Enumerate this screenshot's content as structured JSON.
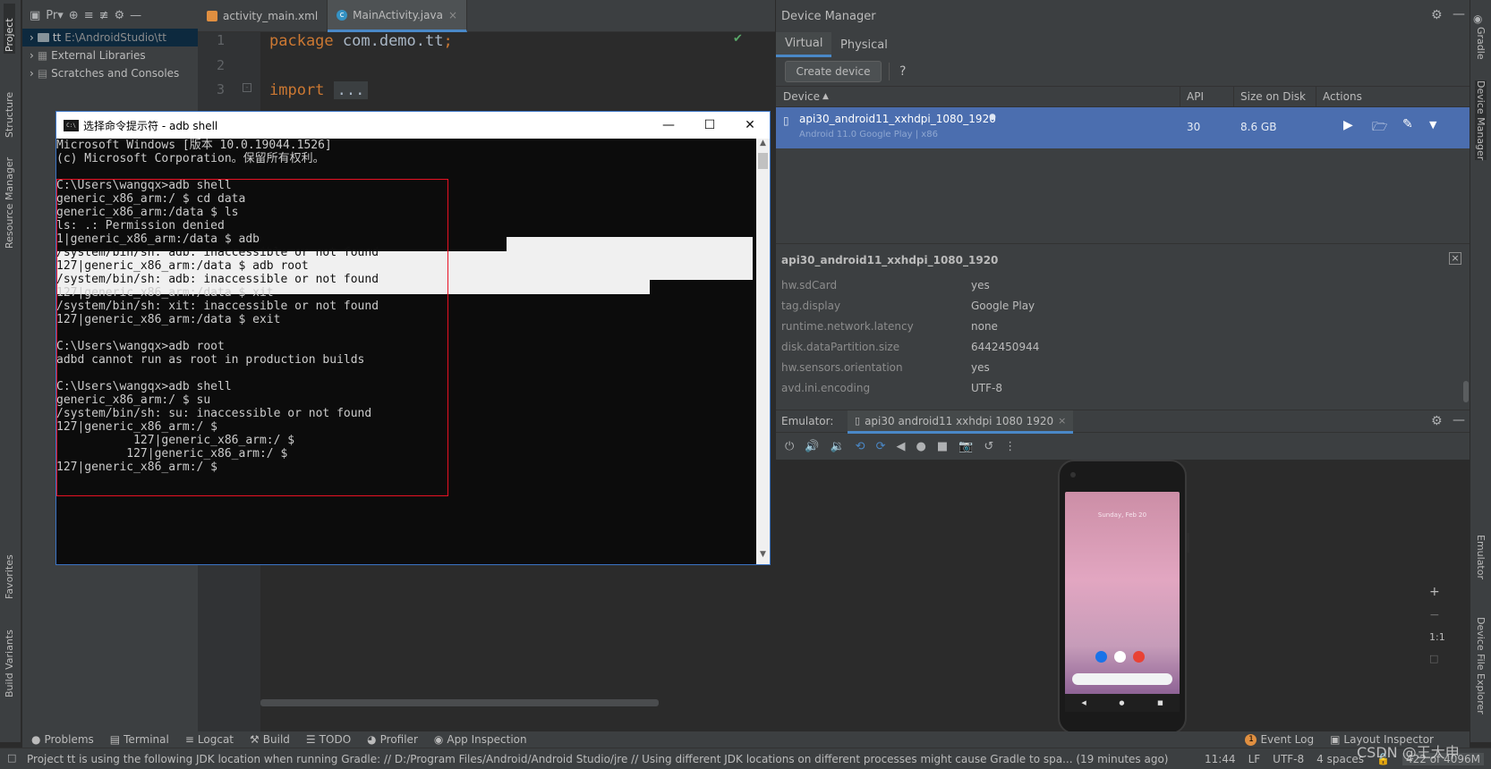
{
  "left_strip": {
    "tabs": [
      "Project",
      "Structure",
      "Resource Manager",
      "Favorites",
      "Build Variants"
    ]
  },
  "right_strip": {
    "tabs": [
      "Gradle",
      "Device Manager",
      "Emulator",
      "Device File Explorer"
    ]
  },
  "project": {
    "dropdown_label": "Pr▾",
    "tree": [
      {
        "name": "tt",
        "path": "E:\\AndroidStudio\\tt",
        "icon": "folder-icon"
      },
      {
        "name": "External Libraries",
        "path": "",
        "icon": "library-icon"
      },
      {
        "name": "Scratches and Consoles",
        "path": "",
        "icon": "scratch-icon"
      }
    ]
  },
  "editor": {
    "tabs": [
      {
        "label": "activity_main.xml",
        "icon": "xml-file-icon"
      },
      {
        "label": "MainActivity.java",
        "icon": "java-class-icon",
        "c_glyph": "c"
      }
    ],
    "line_numbers": [
      "1",
      "2",
      "3"
    ],
    "kw_package": "package",
    "package_name": " com.demo.tt",
    "semicolon": ";",
    "kw_import": "import",
    "import_fold": "...",
    "check_glyph": "✔"
  },
  "cmd": {
    "title": "选择命令提示符 - adb  shell",
    "icon_text": "C:\\",
    "lines": [
      "Microsoft Windows [版本 10.0.19044.1526]",
      "(c) Microsoft Corporation。保留所有权利。",
      "",
      "C:\\Users\\wangqx>adb shell",
      "generic_x86_arm:/ $ cd data",
      "generic_x86_arm:/data $ ls",
      "ls: .: Permission denied",
      "1|generic_x86_arm:/data $ adb",
      "/system/bin/sh: adb: inaccessible or not found",
      "127|generic_x86_arm:/data $ adb root",
      "/system/bin/sh: adb: inaccessible or not found",
      "127|generic_x86_arm:/data $ xit",
      "/system/bin/sh: xit: inaccessible or not found",
      "127|generic_x86_arm:/data $ exit",
      "",
      "C:\\Users\\wangqx>adb root",
      "adbd cannot run as root in production builds",
      "",
      "C:\\Users\\wangqx>adb shell",
      "generic_x86_arm:/ $ su",
      "/system/bin/sh: su: inaccessible or not found",
      "127|generic_x86_arm:/ $",
      "           127|generic_x86_arm:/ $",
      "          127|generic_x86_arm:/ $",
      "127|generic_x86_arm:/ $"
    ]
  },
  "device_manager": {
    "title": "Device Manager",
    "tabs": [
      "Virtual",
      "Physical"
    ],
    "create_button": "Create device",
    "help": "?",
    "columns": [
      "Device",
      "API",
      "Size on Disk",
      "Actions"
    ],
    "sort_arrow": "▲",
    "device": {
      "name": "api30_android11_xxhdpi_1080_1920",
      "status_dot": "●",
      "subtitle": "Android 11.0 Google Play | x86",
      "api": "30",
      "size": "8.6 GB"
    },
    "details": {
      "title": "api30_android11_xxhdpi_1080_1920",
      "rows": [
        {
          "key": "hw.sdCard",
          "value": "yes"
        },
        {
          "key": "tag.display",
          "value": "Google Play"
        },
        {
          "key": "runtime.network.latency",
          "value": "none"
        },
        {
          "key": "disk.dataPartition.size",
          "value": "6442450944"
        },
        {
          "key": "hw.sensors.orientation",
          "value": "yes"
        },
        {
          "key": "avd.ini.encoding",
          "value": "UTF-8"
        }
      ]
    }
  },
  "emulator": {
    "label": "Emulator:",
    "tab": "api30 android11 xxhdpi 1080 1920",
    "phone_time": "Sunday, Feb 20",
    "zoom_fit": "1:1",
    "zoom_in": "+",
    "zoom_out": "−"
  },
  "bottom_tabs": [
    "Problems",
    "Terminal",
    "Logcat",
    "Build",
    "TODO",
    "Profiler",
    "App Inspection"
  ],
  "bottom_right": {
    "event_log": "Event Log",
    "event_count": "1",
    "layout_inspector": "Layout Inspector"
  },
  "status": {
    "message": "Project tt is using the following JDK location when running Gradle: // D:/Program Files/Android/Android Studio/jre // Using different JDK locations on different processes might cause Gradle to spa... (19 minutes ago)",
    "time": "11:44",
    "line_sep": "LF",
    "encoding": "UTF-8",
    "indent": "4 spaces",
    "memory": "422 of 4096M"
  },
  "watermark": "CSDN @王大申",
  "colors": {
    "accent": "#4a88c7",
    "selection": "#4b6eaf",
    "cmd_red_box": "#e81123",
    "check": "#59a869"
  }
}
